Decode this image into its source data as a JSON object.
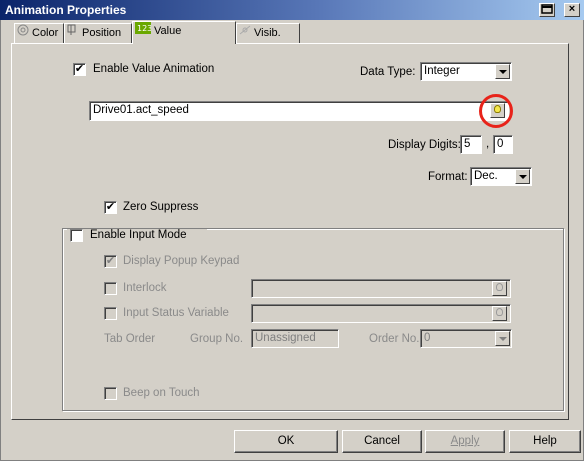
{
  "window": {
    "title": "Animation Properties"
  },
  "tabs": [
    {
      "label": "Color"
    },
    {
      "label": "Position"
    },
    {
      "label": "Value"
    },
    {
      "label": "Visib."
    }
  ],
  "value_tab": {
    "enable_value_animation": {
      "label": "Enable Value Animation",
      "checked": true,
      "mark": "✔"
    },
    "data_type": {
      "label": "Data Type:",
      "value": "Integer"
    },
    "variable": {
      "value": "Drive01.act_speed"
    },
    "display_digits": {
      "label": "Display Digits:",
      "integer": "5",
      "sep": ",",
      "decimal": "0"
    },
    "format": {
      "label": "Format:",
      "value": "Dec."
    },
    "zero_suppress": {
      "label": "Zero Suppress",
      "checked": true,
      "mark": "✔"
    }
  },
  "input_mode": {
    "enable_input_mode": {
      "label": "Enable Input Mode",
      "checked": false
    },
    "display_popup_keypad": {
      "label": "Display Popup Keypad",
      "checked": true,
      "mark": "✔"
    },
    "interlock": {
      "label": "Interlock",
      "checked": false
    },
    "input_status_variable": {
      "label": "Input Status Variable",
      "checked": false
    },
    "tab_order": {
      "label": "Tab Order"
    },
    "group_no": {
      "label": "Group No.",
      "value": "Unassigned"
    },
    "order_no": {
      "label": "Order No.",
      "value": "0"
    },
    "beep_on_touch": {
      "label": "Beep on Touch",
      "checked": false
    }
  },
  "buttons": {
    "ok": "OK",
    "cancel": "Cancel",
    "apply": "Apply",
    "help": "Help"
  },
  "colors": {
    "title_start": "#0a246a",
    "title_end": "#a6caf0",
    "highlight": "#e8231a"
  }
}
